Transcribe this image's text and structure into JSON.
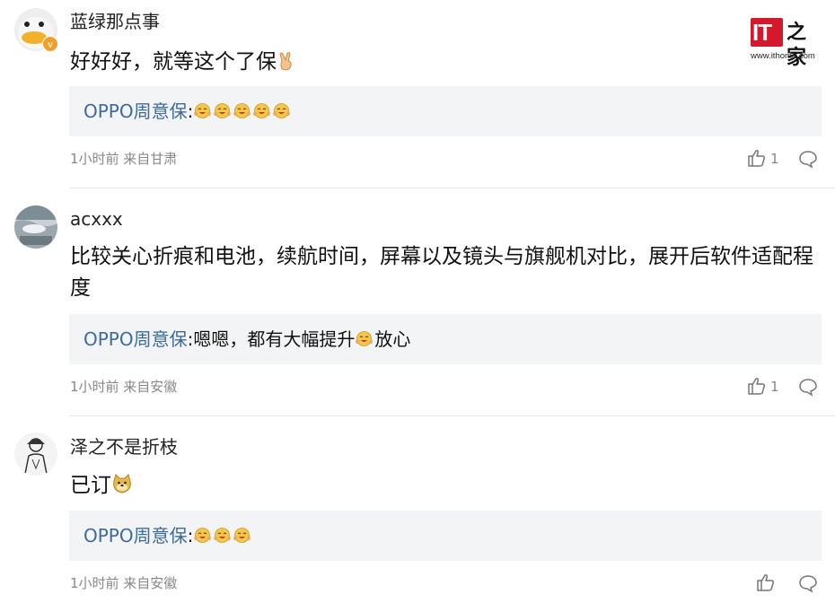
{
  "brand": {
    "logo_text": "IT之家",
    "logo_prefix": "IT",
    "logo_suffix": "之家",
    "url": "www.ithome.com"
  },
  "comments": [
    {
      "username": "蓝绿那点事",
      "text": "好好好，就等这个了保",
      "reply_author": "OPPO周意保",
      "reply_text": "",
      "meta": "1小时前 来自甘肃",
      "likes": "1"
    },
    {
      "username": "acxxx",
      "text": "比较关心折痕和电池，续航时间，屏幕以及镜头与旗舰机对比，展开后软件适配程度",
      "reply_author": "OPPO周意保",
      "reply_text_before": "嗯嗯，都有大幅提升",
      "reply_text_after": "放心",
      "meta": "1小时前 来自安徽",
      "likes": "1"
    },
    {
      "username": "泽之不是折枝",
      "text": "已订",
      "reply_author": "OPPO周意保",
      "reply_text": "",
      "meta": "1小时前 来自安徽",
      "likes": ""
    }
  ],
  "reply_separator": ":",
  "icons": [
    "like-thumb-icon",
    "comment-bubble-icon",
    "victory-hand-emoji",
    "hug-emoji",
    "doge-emoji",
    "verified-badge-icon"
  ],
  "colors": {
    "reply_author": "#3d6b9c",
    "reply_bg": "#f3f4f5",
    "meta": "#888888",
    "verified": "#f0a02a",
    "logo_red": "#d3192b"
  }
}
